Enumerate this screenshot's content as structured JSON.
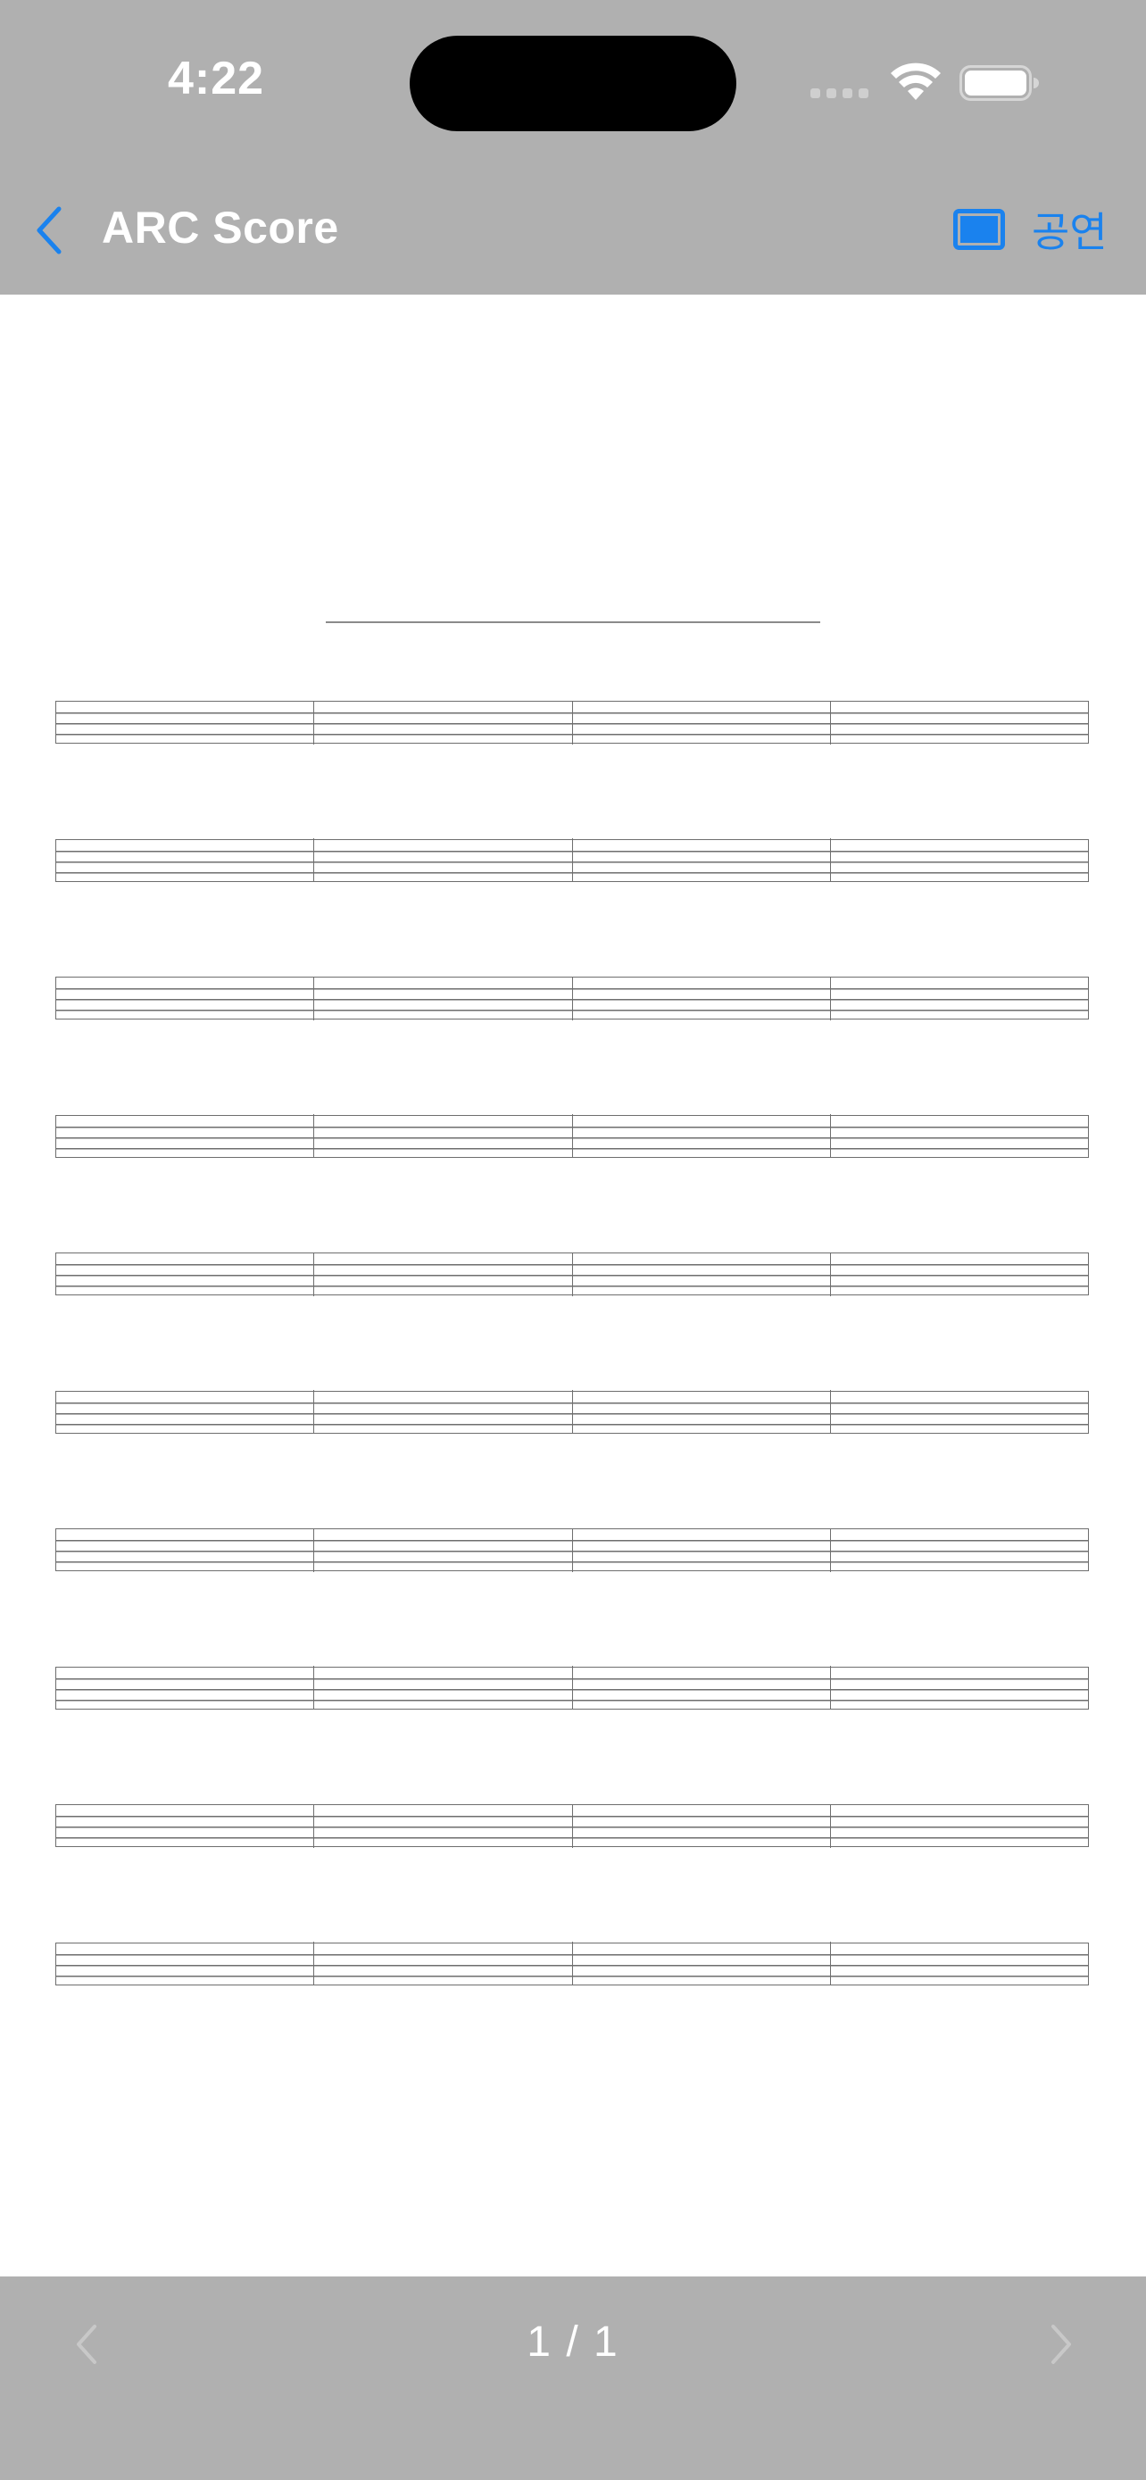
{
  "status_bar": {
    "time": "4:22"
  },
  "nav": {
    "back_icon": "chevron-left-icon",
    "title": "ARC Score",
    "perform_icon": "screen-icon",
    "perform_label": "공연",
    "accent_color": "#1a82ee"
  },
  "score": {
    "title": "",
    "staff_count": 10,
    "measures_per_staff": 4
  },
  "pager": {
    "prev_icon": "chevron-left-icon",
    "next_icon": "chevron-right-icon",
    "label": "1 / 1"
  }
}
